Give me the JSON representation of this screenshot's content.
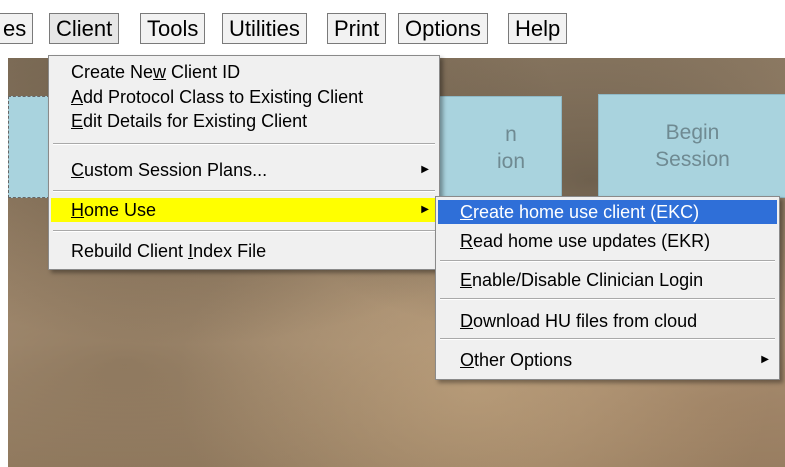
{
  "menubar": {
    "items": [
      {
        "label": "es"
      },
      {
        "label": "Client"
      },
      {
        "label": "Tools"
      },
      {
        "label": "Utilities"
      },
      {
        "label": "Print"
      },
      {
        "label": "Options"
      },
      {
        "label": "Help"
      }
    ]
  },
  "tiles": {
    "mid_line1": "n",
    "mid_line2": "ion",
    "right_line1": "Begin",
    "right_line2": "Session"
  },
  "client_menu": {
    "items": [
      {
        "before": "Create Ne",
        "mnemonic": "w",
        "after": " Client ID"
      },
      {
        "before": "",
        "mnemonic": "A",
        "after": "dd Protocol Class to Existing Client"
      },
      {
        "before": "",
        "mnemonic": "E",
        "after": "dit Details for Existing Client"
      },
      {
        "before": "",
        "mnemonic": "C",
        "after": "ustom Session Plans..."
      },
      {
        "before": "",
        "mnemonic": "H",
        "after": "ome Use"
      },
      {
        "before": "Rebuild Client ",
        "mnemonic": "I",
        "after": "ndex File"
      }
    ],
    "submenu_arrow": "▶"
  },
  "home_use_menu": {
    "items": [
      {
        "before": "",
        "mnemonic": "C",
        "after": "reate home use client (EKC)"
      },
      {
        "before": "",
        "mnemonic": "R",
        "after": "ead home use updates (EKR)"
      },
      {
        "before": "",
        "mnemonic": "E",
        "after": "nable/Disable Clinician Login"
      },
      {
        "before": "",
        "mnemonic": "D",
        "after": "ownload HU files from cloud"
      },
      {
        "before": "",
        "mnemonic": "O",
        "after": "ther Options"
      }
    ],
    "submenu_arrow": "▶"
  },
  "colors": {
    "highlight_yellow": "#ffff00",
    "highlight_blue": "#2f6fd8",
    "tile_blue": "#a9d3de"
  }
}
